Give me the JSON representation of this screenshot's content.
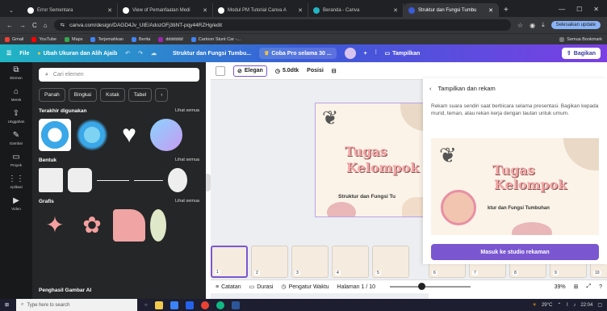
{
  "tabs": [
    {
      "label": "Error Sementara",
      "color": "#ffffff",
      "active": false
    },
    {
      "label": "View of Pemanfaatan Medi",
      "color": "#ffffff",
      "active": false
    },
    {
      "label": "Modul PM Tutorial Canva A",
      "color": "#ffffff",
      "active": false
    },
    {
      "label": "Beranda - Canva",
      "color": "#20b5c4",
      "active": false
    },
    {
      "label": "Struktur dan Fungsi Tumbu",
      "color": "#3a5bd8",
      "active": true
    }
  ],
  "address": {
    "url": "canva.com/design/DAGD4Jv_UtE/AdozOFj3tiNT-pqy44RZHg/edit",
    "update_label": "Selesaikan update"
  },
  "bookmarks": [
    {
      "label": "Gmail",
      "color": "#ea4335"
    },
    {
      "label": "YouTube",
      "color": "#ff0000"
    },
    {
      "label": "Maps",
      "color": "#34a853"
    },
    {
      "label": "Terjemahkan",
      "color": "#4285f4"
    },
    {
      "label": "Berita",
      "color": "#4285f4"
    },
    {
      "label": "ddddddd",
      "color": "#9c27b0"
    },
    {
      "label": "Cartoon Stunt Car -...",
      "color": "#4285f4"
    }
  ],
  "bookmarks_all": "Semua Bookmark",
  "canva_header": {
    "file": "File",
    "resize": "Ubah Ukuran dan Alih Ajaib",
    "doc_title": "Struktur dan Fungsi Tumbu...",
    "try_pro": "Coba Pro selama 30 ...",
    "present": "Tampilkan",
    "share": "Bagikan"
  },
  "rail": [
    {
      "label": "Elemen",
      "icon": "elements-icon"
    },
    {
      "label": "Merek",
      "icon": "brand-icon"
    },
    {
      "label": "Unggahan",
      "icon": "upload-icon"
    },
    {
      "label": "Gambar",
      "icon": "draw-icon"
    },
    {
      "label": "Proyek",
      "icon": "folder-icon"
    },
    {
      "label": "Aplikasi",
      "icon": "apps-icon"
    },
    {
      "label": "Video",
      "icon": "video-icon"
    }
  ],
  "panel": {
    "search_placeholder": "Cari elemen",
    "chips": [
      "Panah",
      "Bingkai",
      "Kotak",
      "Tabel"
    ],
    "recent_title": "Terakhir digunakan",
    "see_all": "Lihat semua",
    "shapes_title": "Bentuk",
    "graphics_title": "Grafis",
    "footer": "Penghasil Gambar AI"
  },
  "toolbar": {
    "font": "Elegan",
    "duration": "5.0dtk",
    "position": "Posisi"
  },
  "slide": {
    "title1": "Tugas",
    "title2": "Kelompok",
    "subtitle": "Struktur dan Fungsi Tu"
  },
  "thumbs": [
    "1",
    "2",
    "3",
    "4",
    "5",
    "6",
    "7",
    "8",
    "9",
    "10"
  ],
  "record_panel": {
    "title": "Tampilkan dan rekam",
    "description": "Rekam suara sendiri saat berbicara selama presentasi. Bagikan kepada murid, teman, atau rekan kerja dengan tautan untuk umum.",
    "preview_title1": "Tugas",
    "preview_title2": "Kelompok",
    "preview_sub": "ktur dan Fungsi Tumbuhan",
    "button": "Masuk ke studio rekaman"
  },
  "status": {
    "notes": "Catatan",
    "duration": "Durasi",
    "timer": "Pengatur Waktu",
    "page": "Halaman 1 / 10",
    "zoom": "39%",
    "zoom_fraction": 0.39
  },
  "taskbar": {
    "search": "Type here to search",
    "weather": "29°C",
    "time": "22:04"
  }
}
